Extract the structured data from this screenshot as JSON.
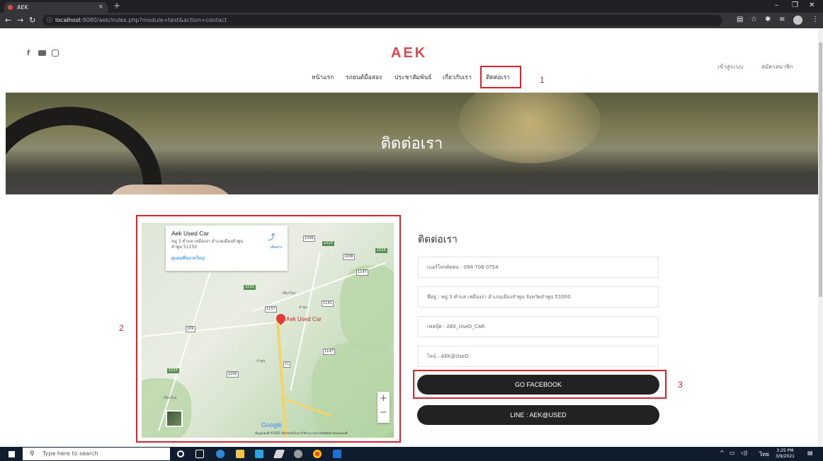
{
  "browser": {
    "tab_title": "AEK",
    "new_tab": "+",
    "url_host": "localhost",
    "url_rest": ":8080/aek/index.php?module=test&action=contact",
    "minimize": "–",
    "maximize": "❐",
    "close": "✕"
  },
  "site": {
    "logo": "AEK",
    "login": "เข้าสู่ระบบ",
    "register": "สมัครสมาชิก",
    "nav": [
      "หน้าแรก",
      "รถยนต์มือสอง",
      "ประชาสัมพันธ์",
      "เกี่ยวกับเรา",
      "ติดต่อเรา"
    ],
    "hero_title": "ติดต่อเรา"
  },
  "annotations": {
    "label_1": "1",
    "label_2": "2",
    "label_3": "3",
    "accent": "#d9232e"
  },
  "map": {
    "place_name": "Aek Used Car",
    "address": "หมู่ 3 ตำบล เหมืองง่า อำเภอเมืองลำพูน ลำพูน 51150",
    "directions": "เส้นทาง",
    "larger_map": "ดูแผนที่ขนาดใหญ่",
    "pin_label": "Aek Used Car",
    "zoom_in": "+",
    "zoom_out": "−",
    "google": "Google",
    "footer": "ข้อมูลแผนที่ ©2021   ข้อกำหนดในการใช้งาน   รายงานข้อผิดพลาดของแผนที่",
    "shields": [
      "1006",
      "1147",
      "1015",
      "1016",
      "1008",
      "1033",
      "1141",
      "1157",
      "11",
      "106",
      "1006",
      "1015",
      "1147"
    ],
    "towns": [
      "เชียงใหม่",
      "ลำพูน",
      "ลำพูน",
      "เชียงใหม่"
    ]
  },
  "contact": {
    "title": "ติดต่อเรา",
    "phone": "เบอร์โทรติดต่อ : 094 708 0754",
    "address": "ที่อยู่ : หมู่ 3 ตำบล เหมืองง่า อำเภอเมืองลำพูน จังหวัดลำพูน 51000",
    "facebook": "เฟสบุ๊ค : AEK_UseD_CAR",
    "line": "ไลน์ : AEK@UseD",
    "btn_facebook": "GO FACEBOOK",
    "btn_line": "LINE : AEK@USED"
  },
  "taskbar": {
    "search_placeholder": "Type here to search",
    "lang": "ไทย",
    "time": "3:25 PM",
    "date": "3/9/2021"
  }
}
